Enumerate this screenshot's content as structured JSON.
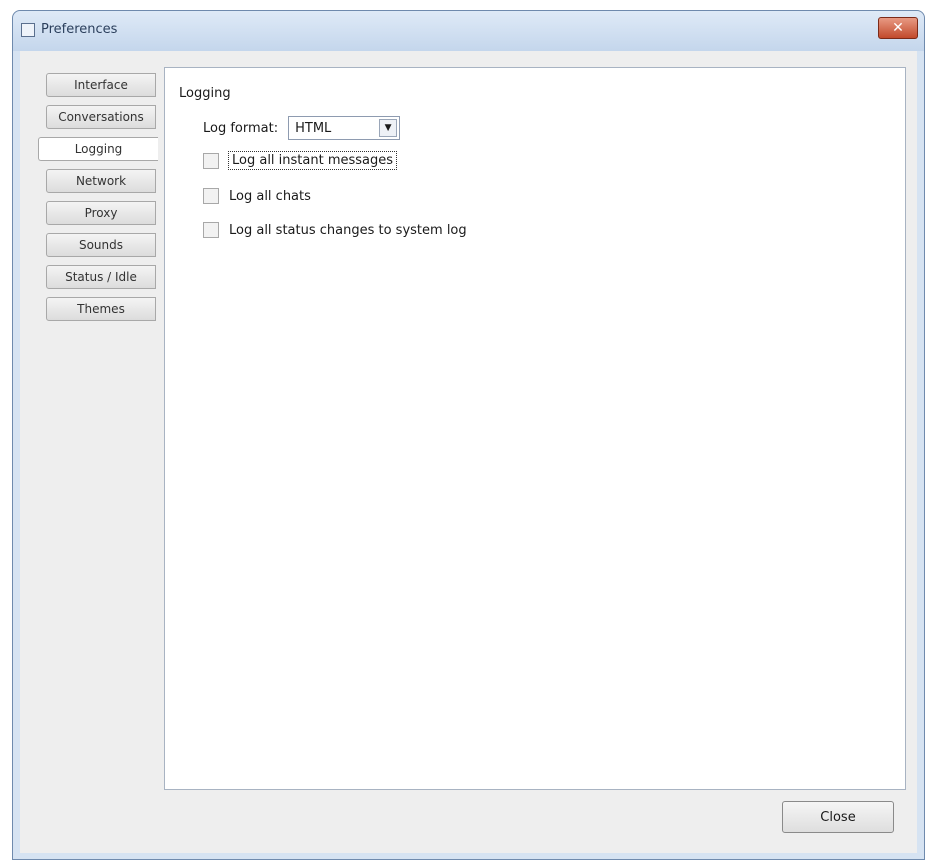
{
  "window": {
    "title": "Preferences",
    "close_glyph": "✕"
  },
  "tabs": [
    {
      "label": "Interface",
      "active": false
    },
    {
      "label": "Conversations",
      "active": false
    },
    {
      "label": "Logging",
      "active": true
    },
    {
      "label": "Network",
      "active": false
    },
    {
      "label": "Proxy",
      "active": false
    },
    {
      "label": "Sounds",
      "active": false
    },
    {
      "label": "Status / Idle",
      "active": false
    },
    {
      "label": "Themes",
      "active": false
    }
  ],
  "logging": {
    "group_label": "Logging",
    "log_format_label": "Log format:",
    "log_format_value": "HTML",
    "dropdown_arrow": "▼",
    "options": [
      {
        "label": "Log all instant messages",
        "checked": false
      },
      {
        "label": "Log all chats",
        "checked": false
      },
      {
        "label": "Log all status changes to system log",
        "checked": false
      }
    ]
  },
  "footer": {
    "close_label": "Close"
  }
}
